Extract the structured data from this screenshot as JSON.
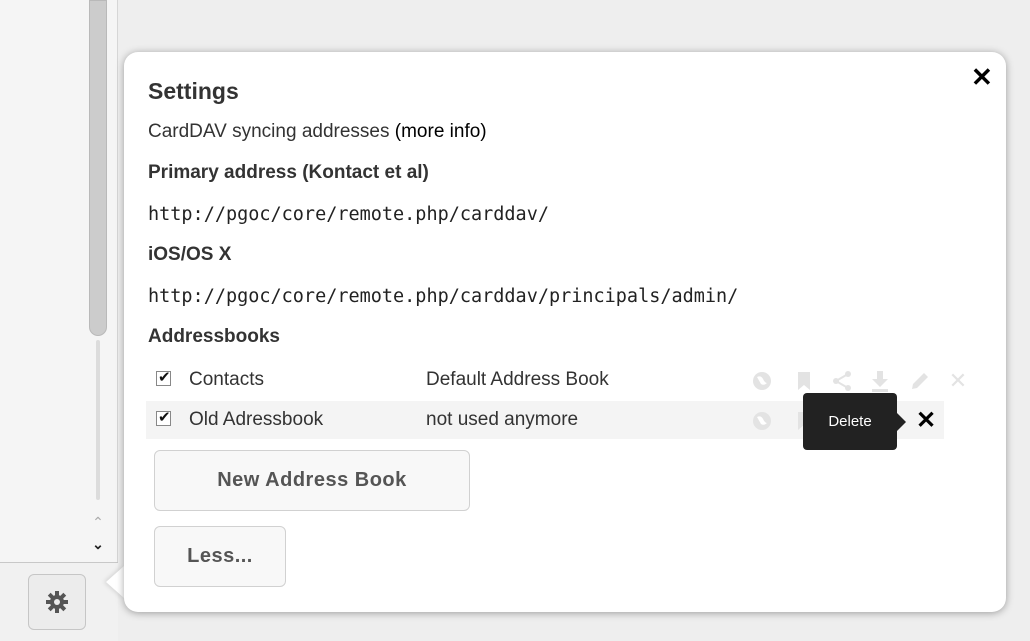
{
  "popup": {
    "close_icon": "close-icon",
    "title": "Settings",
    "intro_text": "CardDAV syncing addresses",
    "more_info_link": "(more info)",
    "primary_heading": "Primary address (Kontact et al)",
    "primary_url": "http://pgoc/core/remote.php/carddav/",
    "ios_heading": "iOS/OS X",
    "ios_url": "http://pgoc/core/remote.php/carddav/principals/admin/",
    "addressbooks_heading": "Addressbooks",
    "addressbooks": [
      {
        "checked": true,
        "name": "Contacts",
        "description": "Default Address Book",
        "actions": [
          "globe-icon",
          "bookmark-icon",
          "share-icon",
          "download-icon",
          "edit-icon",
          "delete-icon"
        ]
      },
      {
        "checked": true,
        "name": "Old Adressbook",
        "description": "not used anymore",
        "actions": [
          "globe-icon",
          "bookmark-icon",
          "delete-icon"
        ]
      }
    ],
    "tooltip": "Delete",
    "new_address_book_button": "New Address Book",
    "less_button": "Less..."
  },
  "sidebar": {
    "settings_icon": "gear-icon",
    "scroll_up_icon": "chevron-up-icon",
    "scroll_down_icon": "chevron-down-icon"
  },
  "colors": {
    "popup_bg": "#ffffff",
    "tooltip_bg": "#222222",
    "action_icon_inactive": "#e3e3e3"
  }
}
